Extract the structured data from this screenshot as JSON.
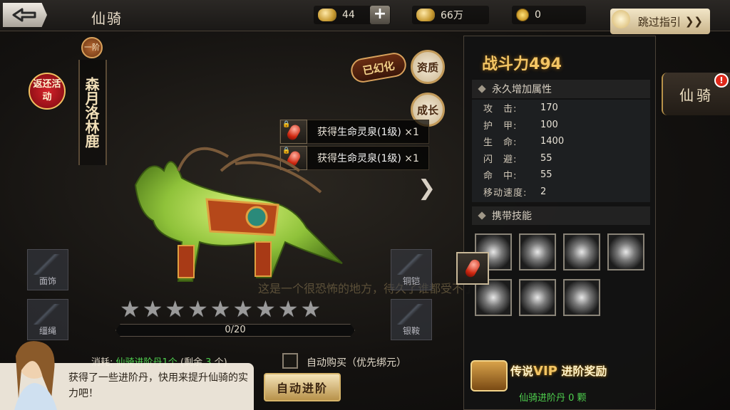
{
  "header": {
    "title": "仙骑",
    "ingot": "44",
    "silver": "66万",
    "coins": "0",
    "skip_label": "跳过指引"
  },
  "mount": {
    "rank": "一阶",
    "name": "森月洛林鹿",
    "event_label": "返还活动",
    "transformed_label": "已幻化",
    "aptitude_label": "资质",
    "growth_label": "成长"
  },
  "rewards": [
    {
      "prefix": "获得",
      "item": "生命灵泉(1级)",
      "count": "×1"
    },
    {
      "prefix": "获得",
      "item": "生命灵泉(1级)",
      "count": "×1"
    }
  ],
  "equip_slots": {
    "face": "面饰",
    "reins": "缰绳",
    "armor": "铜铠",
    "saddle": "银鞍"
  },
  "advance": {
    "stars_total": 9,
    "stars_filled": 0,
    "progress_current": 0,
    "progress_max": 20,
    "progress_text": "0/20",
    "cost_label": "消耗:",
    "cost_item": "仙骑进阶丹1个",
    "cost_remaining_prefix": "(剩余",
    "cost_remaining_value": "3",
    "cost_remaining_suffix": "个)",
    "auto_buy_label": "自动购买（优先绑元）",
    "auto_button": "自动进阶",
    "bg_hint": "这是一个很恐怖的地方，待久了谁都受不了"
  },
  "dialog": {
    "text": "获得了一些进阶丹，快用来提升仙骑的实力吧！"
  },
  "panel": {
    "power_label": "战斗力",
    "power_value": "494",
    "attr_header": "永久增加属性",
    "stats": [
      {
        "key": "攻　击:",
        "value": "170"
      },
      {
        "key": "护　甲:",
        "value": "100"
      },
      {
        "key": "生　命:",
        "value": "1400"
      },
      {
        "key": "闪　避:",
        "value": "55"
      },
      {
        "key": "命　中:",
        "value": "55"
      },
      {
        "key": "移动速度:",
        "value": "2"
      }
    ],
    "skills_header": "携带技能",
    "vip_title_prefix": "传说",
    "vip_title_vip": "VIP",
    "vip_title_suffix": "进阶奖励",
    "vip_sub": "仙骑进阶丹  0 颗"
  },
  "side_tab": {
    "label": "仙骑",
    "alert": "!"
  },
  "colors": {
    "gold": "#f3c564",
    "green": "#4fd14f",
    "alert": "#e0281a"
  }
}
